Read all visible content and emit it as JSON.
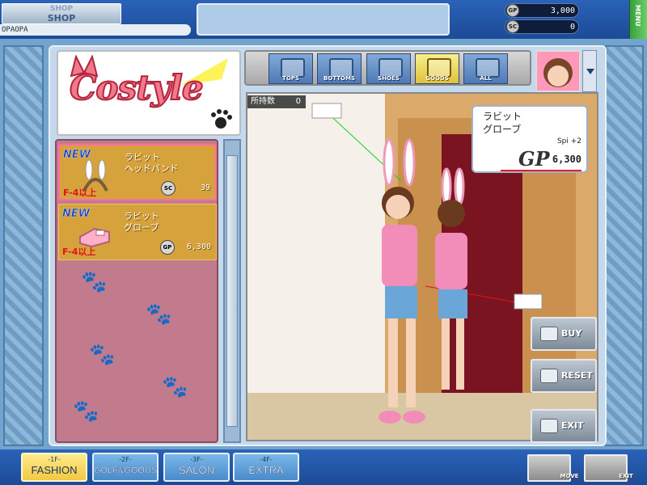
{
  "header": {
    "shop_label_top": "SHOP",
    "shop_label": "SHOP",
    "player_name": "OPAOPA",
    "currencies": [
      {
        "icon": "GP",
        "value": "3,000"
      },
      {
        "icon": "SC",
        "value": "0"
      }
    ],
    "menu_label": "MENU"
  },
  "logo": {
    "text": "Costyle"
  },
  "items": [
    {
      "badge": "NEW",
      "name_line1": "ラビット",
      "name_line2": "ヘッドバンド",
      "requirement": "F-4以上",
      "currency": "SC",
      "price": "39"
    },
    {
      "badge": "NEW",
      "name_line1": "ラビット",
      "name_line2": "グローブ",
      "requirement": "F-4以上",
      "currency": "GP",
      "price": "6,300"
    }
  ],
  "categories": [
    {
      "label": "TOPS",
      "icon": "shirt-icon"
    },
    {
      "label": "BOTTOMS",
      "icon": "pants-icon"
    },
    {
      "label": "SHOES",
      "icon": "shoe-icon"
    },
    {
      "label": "GOODS",
      "icon": "cap-icon"
    },
    {
      "label": "ALL",
      "icon": "outfit-icon"
    }
  ],
  "viewer": {
    "owned_label": "所持数",
    "owned_count": "0"
  },
  "price_tag": {
    "line1": "ラビット",
    "line2": "グローブ",
    "stat": "Spi +2",
    "currency": "GP",
    "price": "6,300"
  },
  "actions": {
    "buy": "BUY",
    "reset": "RESET",
    "exit": "EXIT"
  },
  "floors": [
    {
      "num": "-1F-",
      "label": "FASHION"
    },
    {
      "num": "-2F-",
      "label": "GOLF&GOODS"
    },
    {
      "num": "-3F-",
      "label": "SALON"
    },
    {
      "num": "-4F-",
      "label": "EXTRA"
    }
  ],
  "nav": {
    "move": "MOVE",
    "exit": "EXIT"
  },
  "colors": {
    "accent_blue": "#2a63b8",
    "gold": "#d6a23b",
    "pink_panel": "#c27a8d",
    "price_red": "#e51c23"
  }
}
